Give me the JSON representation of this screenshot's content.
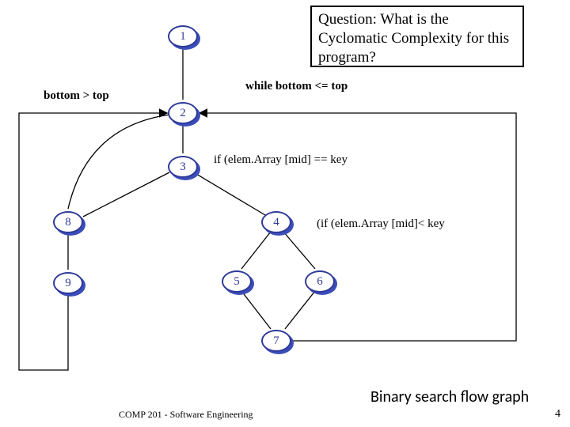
{
  "question": "Question: What is the Cyclomatic Complexity for this program?",
  "nodes": {
    "n1": "1",
    "n2": "2",
    "n3": "3",
    "n4": "4",
    "n5": "5",
    "n6": "6",
    "n7": "7",
    "n8": "8",
    "n9": "9"
  },
  "labels": {
    "bottom_gt_top": "bottom > top",
    "while_cond": "while bottom <= top",
    "if_eq": "if (elem.Array [mid] == key",
    "if_lt": "(if (elem.Array [mid]< key"
  },
  "caption": "Binary search flow graph",
  "footer_course": "COMP 201 - Software Engineering",
  "page_number": "4",
  "chart_data": {
    "type": "flowgraph",
    "title": "Binary search flow graph",
    "nodes": [
      1,
      2,
      3,
      4,
      5,
      6,
      7,
      8,
      9
    ],
    "edges": [
      {
        "from": 1,
        "to": 2
      },
      {
        "from": 2,
        "to": 3,
        "label": "while bottom <= top"
      },
      {
        "from": 2,
        "to": 8,
        "label": "bottom > top"
      },
      {
        "from": 8,
        "to": 9
      },
      {
        "from": 3,
        "to": 4,
        "label": "if (elem.Array [mid] == key"
      },
      {
        "from": 4,
        "to": 5
      },
      {
        "from": 4,
        "to": 6,
        "label": "(if (elem.Array [mid]< key"
      },
      {
        "from": 5,
        "to": 7
      },
      {
        "from": 6,
        "to": 7
      },
      {
        "from": 7,
        "to": 2
      },
      {
        "from": 3,
        "to": 8
      }
    ]
  }
}
